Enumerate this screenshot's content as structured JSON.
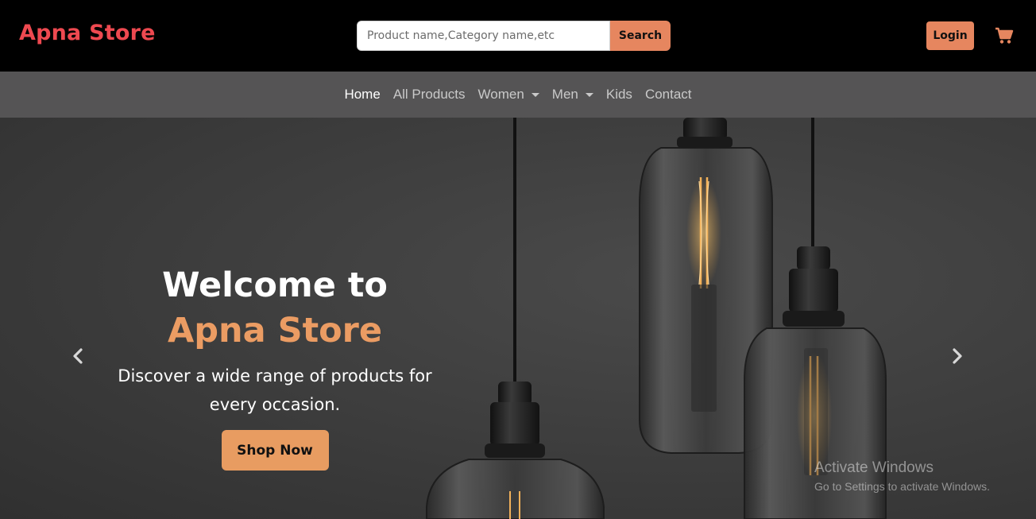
{
  "header": {
    "brand": "Apna Store",
    "search": {
      "placeholder": "Product name,Category name,etc",
      "button_label": "Search"
    },
    "login_label": "Login",
    "cart_icon": "cart-icon",
    "colors": {
      "brand": "#ee4950",
      "accent": "#e6865f"
    }
  },
  "nav": {
    "items": [
      {
        "label": "Home",
        "active": true
      },
      {
        "label": "All Products"
      },
      {
        "label": "Women",
        "dropdown": true
      },
      {
        "label": "Men",
        "dropdown": true
      },
      {
        "label": "Kids"
      },
      {
        "label": "Contact"
      }
    ]
  },
  "hero": {
    "title_line1": "Welcome to",
    "title_line2": "Apna Store",
    "description": "Discover a wide range of products for every occasion.",
    "cta_label": "Shop Now",
    "prev_icon": "chevron-left-icon",
    "next_icon": "chevron-right-icon"
  },
  "watermark": {
    "line1": "Activate Windows",
    "line2": "Go to Settings to activate Windows."
  }
}
